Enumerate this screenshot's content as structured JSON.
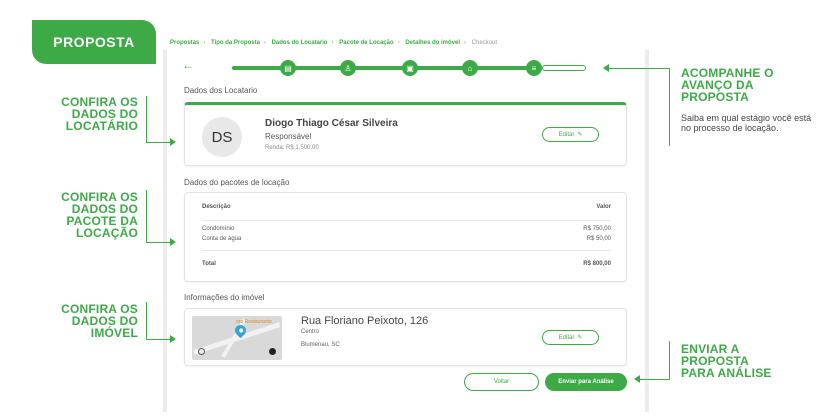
{
  "badge": {
    "label": "PROPOSTA"
  },
  "breadcrumb": {
    "items": [
      "Propostas",
      "Tipo da Proposta",
      "Dados do Locatario",
      "Pacote de Locação",
      "Detalhes do imóvel"
    ],
    "current": "Checkout",
    "separator": "›"
  },
  "stepper": {
    "back_icon": "arrow-left-icon",
    "steps": [
      "list-icon",
      "user-icon",
      "package-icon",
      "home-icon",
      "checklist-icon"
    ],
    "active_color": "#3daa47"
  },
  "tenant_section": {
    "title": "Dados dos Locatario",
    "initials": "DS",
    "name": "Diogo Thiago César Silveira",
    "role": "Responsável",
    "income_label": "Renda:",
    "income_value": "R$ 1.500,00",
    "edit_label": "Editar"
  },
  "package_section": {
    "title": "Dados do pacotes de locação",
    "col_description": "Descrição",
    "col_value": "Valor",
    "rows": [
      {
        "label": "Condomínio",
        "value": "R$ 750,00"
      },
      {
        "label": "Conta de água",
        "value": "R$ 50,00"
      }
    ],
    "total_label": "Total",
    "total_value": "R$ 800,00"
  },
  "property_section": {
    "title": "Informações do imóvel",
    "map_label": "oro Restaurante",
    "street": "Rua Floriano Peixoto, 126",
    "district": "Centro",
    "city": "Blumenau, SC",
    "edit_label": "Editar"
  },
  "actions": {
    "back_label": "Voltar",
    "send_label": "Enviar para Análise"
  },
  "callouts": {
    "tenant": [
      "CONFIRA OS",
      "DADOS DO",
      "LOCATÁRIO"
    ],
    "package": [
      "CONFIRA OS",
      "DADOS DO",
      "PACOTE DA",
      "LOCAÇÃO"
    ],
    "property": [
      "CONFIRA OS",
      "DADOS DO",
      "IMÓVEL"
    ],
    "progress": [
      "ACOMPANHE O",
      "AVANÇO DA",
      "PROPOSTA"
    ],
    "progress_sub": "Saiba em qual estágio você está no processo de locação.",
    "send": [
      "ENVIAR A",
      "PROPOSTA",
      "PARA ANÁLISE"
    ]
  }
}
